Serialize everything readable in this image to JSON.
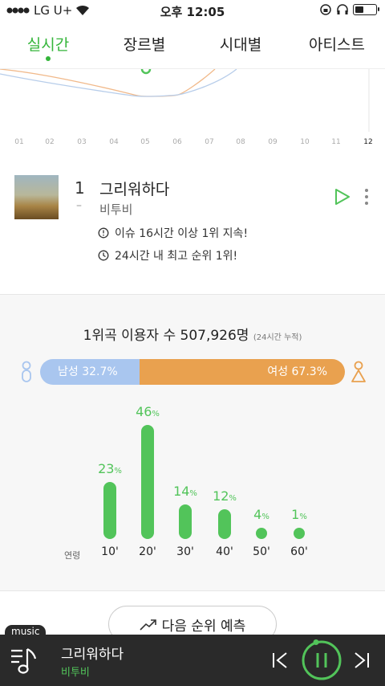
{
  "status": {
    "carrier": "LG U+",
    "time": "오후 12:05",
    "battery_level": 0.4
  },
  "tabs": [
    {
      "label": "실시간",
      "active": true
    },
    {
      "label": "장르별",
      "active": false
    },
    {
      "label": "시대별",
      "active": false
    },
    {
      "label": "아티스트",
      "active": false
    }
  ],
  "hours": [
    "01",
    "02",
    "03",
    "04",
    "05",
    "06",
    "07",
    "08",
    "09",
    "10",
    "11",
    "12"
  ],
  "active_hour": "12",
  "song": {
    "rank": "1",
    "rank_change": "–",
    "title": "그리워하다",
    "artist": "비투비",
    "info": [
      {
        "icon": "clock-alert-icon",
        "text": "이슈 16시간 이상 1위 지속!"
      },
      {
        "icon": "clock-icon",
        "text": "24시간 내 최고 순위 1위!"
      }
    ]
  },
  "stats": {
    "title_prefix": "1위곡 이용자 수",
    "title_value": "507,926명",
    "title_note": "(24시간 누적)",
    "male_label": "남성 32.7%",
    "female_label": "여성 67.3%",
    "male_share": 32.7,
    "female_share": 67.3,
    "male_color": "#a9c6ef",
    "female_color": "#e9a14f",
    "age_title": "연령",
    "ages": [
      {
        "label": "10'",
        "value": "23",
        "pct": 23
      },
      {
        "label": "20'",
        "value": "46",
        "pct": 46
      },
      {
        "label": "30'",
        "value": "14",
        "pct": 14
      },
      {
        "label": "40'",
        "value": "12",
        "pct": 12
      },
      {
        "label": "50'",
        "value": "4",
        "pct": 4
      },
      {
        "label": "60'",
        "value": "1",
        "pct": 1
      }
    ],
    "pct_unit": "%"
  },
  "next_button": "다음 순위 예측",
  "player": {
    "badge": "music",
    "title": "그리워하다",
    "artist": "비투비"
  },
  "colors": {
    "accent": "#34b53a",
    "bar": "#52c45a",
    "player_bg": "#2a2a2a"
  }
}
